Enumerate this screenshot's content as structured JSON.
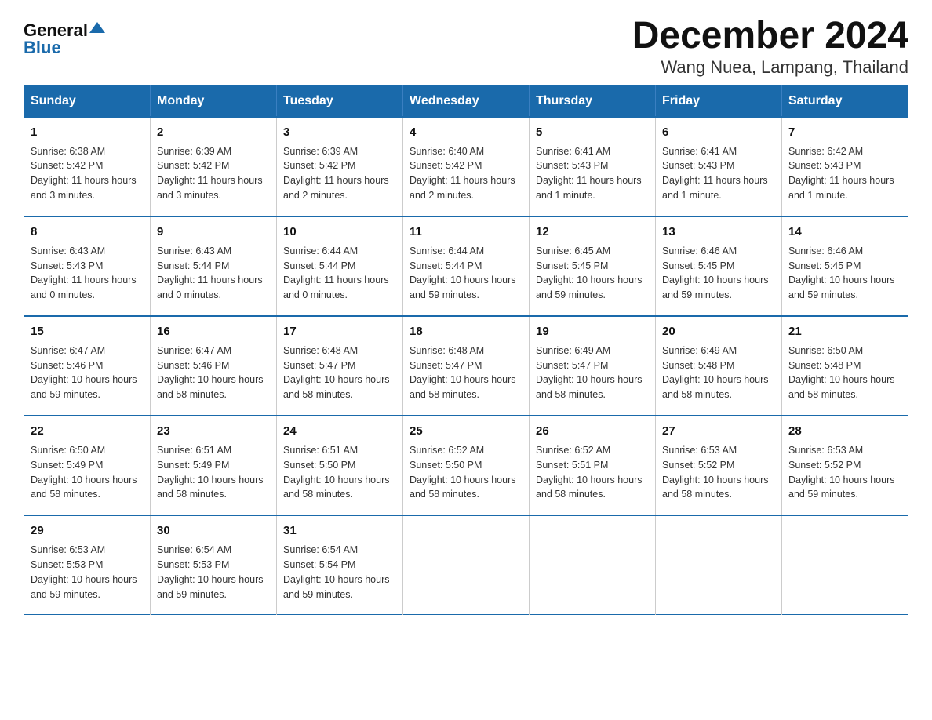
{
  "logo": {
    "general": "General",
    "blue": "Blue"
  },
  "title": "December 2024",
  "subtitle": "Wang Nuea, Lampang, Thailand",
  "days_of_week": [
    "Sunday",
    "Monday",
    "Tuesday",
    "Wednesday",
    "Thursday",
    "Friday",
    "Saturday"
  ],
  "weeks": [
    [
      {
        "day": "1",
        "sunrise": "6:38 AM",
        "sunset": "5:42 PM",
        "daylight": "11 hours and 3 minutes."
      },
      {
        "day": "2",
        "sunrise": "6:39 AM",
        "sunset": "5:42 PM",
        "daylight": "11 hours and 3 minutes."
      },
      {
        "day": "3",
        "sunrise": "6:39 AM",
        "sunset": "5:42 PM",
        "daylight": "11 hours and 2 minutes."
      },
      {
        "day": "4",
        "sunrise": "6:40 AM",
        "sunset": "5:42 PM",
        "daylight": "11 hours and 2 minutes."
      },
      {
        "day": "5",
        "sunrise": "6:41 AM",
        "sunset": "5:43 PM",
        "daylight": "11 hours and 1 minute."
      },
      {
        "day": "6",
        "sunrise": "6:41 AM",
        "sunset": "5:43 PM",
        "daylight": "11 hours and 1 minute."
      },
      {
        "day": "7",
        "sunrise": "6:42 AM",
        "sunset": "5:43 PM",
        "daylight": "11 hours and 1 minute."
      }
    ],
    [
      {
        "day": "8",
        "sunrise": "6:43 AM",
        "sunset": "5:43 PM",
        "daylight": "11 hours and 0 minutes."
      },
      {
        "day": "9",
        "sunrise": "6:43 AM",
        "sunset": "5:44 PM",
        "daylight": "11 hours and 0 minutes."
      },
      {
        "day": "10",
        "sunrise": "6:44 AM",
        "sunset": "5:44 PM",
        "daylight": "11 hours and 0 minutes."
      },
      {
        "day": "11",
        "sunrise": "6:44 AM",
        "sunset": "5:44 PM",
        "daylight": "10 hours and 59 minutes."
      },
      {
        "day": "12",
        "sunrise": "6:45 AM",
        "sunset": "5:45 PM",
        "daylight": "10 hours and 59 minutes."
      },
      {
        "day": "13",
        "sunrise": "6:46 AM",
        "sunset": "5:45 PM",
        "daylight": "10 hours and 59 minutes."
      },
      {
        "day": "14",
        "sunrise": "6:46 AM",
        "sunset": "5:45 PM",
        "daylight": "10 hours and 59 minutes."
      }
    ],
    [
      {
        "day": "15",
        "sunrise": "6:47 AM",
        "sunset": "5:46 PM",
        "daylight": "10 hours and 59 minutes."
      },
      {
        "day": "16",
        "sunrise": "6:47 AM",
        "sunset": "5:46 PM",
        "daylight": "10 hours and 58 minutes."
      },
      {
        "day": "17",
        "sunrise": "6:48 AM",
        "sunset": "5:47 PM",
        "daylight": "10 hours and 58 minutes."
      },
      {
        "day": "18",
        "sunrise": "6:48 AM",
        "sunset": "5:47 PM",
        "daylight": "10 hours and 58 minutes."
      },
      {
        "day": "19",
        "sunrise": "6:49 AM",
        "sunset": "5:47 PM",
        "daylight": "10 hours and 58 minutes."
      },
      {
        "day": "20",
        "sunrise": "6:49 AM",
        "sunset": "5:48 PM",
        "daylight": "10 hours and 58 minutes."
      },
      {
        "day": "21",
        "sunrise": "6:50 AM",
        "sunset": "5:48 PM",
        "daylight": "10 hours and 58 minutes."
      }
    ],
    [
      {
        "day": "22",
        "sunrise": "6:50 AM",
        "sunset": "5:49 PM",
        "daylight": "10 hours and 58 minutes."
      },
      {
        "day": "23",
        "sunrise": "6:51 AM",
        "sunset": "5:49 PM",
        "daylight": "10 hours and 58 minutes."
      },
      {
        "day": "24",
        "sunrise": "6:51 AM",
        "sunset": "5:50 PM",
        "daylight": "10 hours and 58 minutes."
      },
      {
        "day": "25",
        "sunrise": "6:52 AM",
        "sunset": "5:50 PM",
        "daylight": "10 hours and 58 minutes."
      },
      {
        "day": "26",
        "sunrise": "6:52 AM",
        "sunset": "5:51 PM",
        "daylight": "10 hours and 58 minutes."
      },
      {
        "day": "27",
        "sunrise": "6:53 AM",
        "sunset": "5:52 PM",
        "daylight": "10 hours and 58 minutes."
      },
      {
        "day": "28",
        "sunrise": "6:53 AM",
        "sunset": "5:52 PM",
        "daylight": "10 hours and 59 minutes."
      }
    ],
    [
      {
        "day": "29",
        "sunrise": "6:53 AM",
        "sunset": "5:53 PM",
        "daylight": "10 hours and 59 minutes."
      },
      {
        "day": "30",
        "sunrise": "6:54 AM",
        "sunset": "5:53 PM",
        "daylight": "10 hours and 59 minutes."
      },
      {
        "day": "31",
        "sunrise": "6:54 AM",
        "sunset": "5:54 PM",
        "daylight": "10 hours and 59 minutes."
      },
      null,
      null,
      null,
      null
    ]
  ],
  "labels": {
    "sunrise": "Sunrise:",
    "sunset": "Sunset:",
    "daylight": "Daylight:"
  }
}
